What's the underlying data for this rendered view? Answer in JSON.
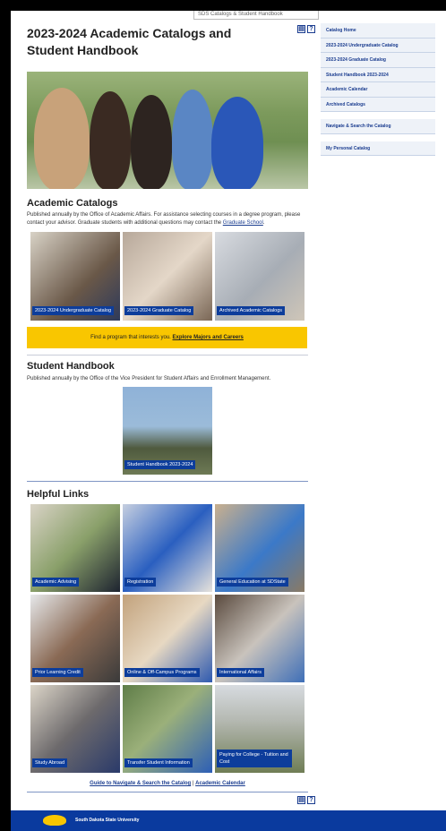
{
  "top_search": {
    "text": "SDS Catalogs & Student Handbook"
  },
  "page": {
    "title": "2023-2024 Academic Catalogs and Student Handbook"
  },
  "icons": {
    "print": "print-icon",
    "help": "help-icon"
  },
  "academic": {
    "heading": "Academic Catalogs",
    "desc_before": "Published annually by the Office of Academic Affairs. For assistance selecting courses in a degree program, please contact your advisor. Graduate students with additional questions may contact the ",
    "desc_link": "Graduate School",
    "desc_after": ".",
    "tiles": [
      {
        "label": "2023-2024 Undergraduate Catalog"
      },
      {
        "label": "2023-2024 Graduate Catalog"
      },
      {
        "label": "Archived Academic Catalogs"
      }
    ],
    "cta_text": "Find a program that interests you. ",
    "cta_link": "Explore Majors and Careers"
  },
  "handbook": {
    "heading": "Student Handbook",
    "desc": "Published annually by the Office of the Vice President for Student Affairs and Enrollment Management.",
    "tile_label": "Student Handbook 2023-2024"
  },
  "helpful": {
    "heading": "Helpful Links",
    "tiles": [
      {
        "label": "Academic Advising"
      },
      {
        "label": "Registration"
      },
      {
        "label": "General Education at SDState"
      },
      {
        "label": "Prior Learning Credit"
      },
      {
        "label": "Online & Off-Campus Programs"
      },
      {
        "label": "International Affairs"
      },
      {
        "label": "Study Abroad"
      },
      {
        "label": "Transfer Student Information"
      },
      {
        "label": "Paying for College - Tuition and Cost"
      }
    ]
  },
  "bottom_links": {
    "guide": "Guide to Navigate & Search the Catalog",
    "sep": " | ",
    "calendar": "Academic Calendar"
  },
  "sidebar": {
    "items": [
      {
        "label": "Catalog Home"
      },
      {
        "label": "2023-2024 Undergraduate Catalog"
      },
      {
        "label": "2023-2024 Graduate Catalog"
      },
      {
        "label": "Student Handbook 2023-2024"
      },
      {
        "label": "Academic Calendar"
      },
      {
        "label": "Archived Catalogs"
      }
    ],
    "navigate": "Navigate & Search the Catalog",
    "personal": "My Personal Catalog"
  },
  "footer": {
    "name": "South Dakota State University"
  },
  "colors": {
    "brand_blue": "#0d3d9b",
    "brand_yellow": "#f9c600"
  }
}
